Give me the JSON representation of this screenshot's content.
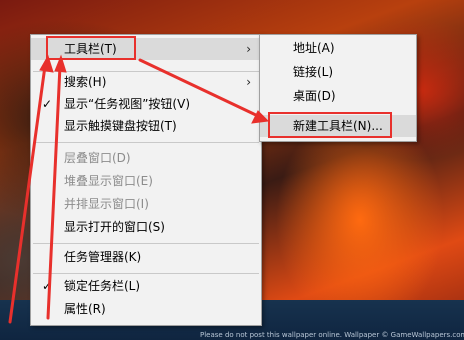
{
  "main_menu": {
    "items": [
      {
        "label": "工具栏(T)",
        "submenu": true
      },
      {
        "label": "搜索(H)",
        "submenu": true
      },
      {
        "label": "显示“任务视图”按钮(V)",
        "checked": true
      },
      {
        "label": "显示触摸键盘按钮(T)"
      },
      {
        "label": "层叠窗口(D)",
        "disabled": true
      },
      {
        "label": "堆叠显示窗口(E)",
        "disabled": true
      },
      {
        "label": "并排显示窗口(I)",
        "disabled": true
      },
      {
        "label": "显示打开的窗口(S)"
      },
      {
        "label": "任务管理器(K)"
      },
      {
        "label": "锁定任务栏(L)",
        "checked": true
      },
      {
        "label": "属性(R)"
      }
    ]
  },
  "sub_menu": {
    "items": [
      {
        "label": "地址(A)"
      },
      {
        "label": "链接(L)"
      },
      {
        "label": "桌面(D)"
      },
      {
        "label": "新建工具栏(N)..."
      }
    ]
  },
  "glyphs": {
    "check": "✓",
    "chevron": "›"
  },
  "annotation_color": "#e8302c",
  "watermark": "Please do not post this wallpaper online. Wallpaper © GameWallpapers.com. Artwork © developer, publisher"
}
